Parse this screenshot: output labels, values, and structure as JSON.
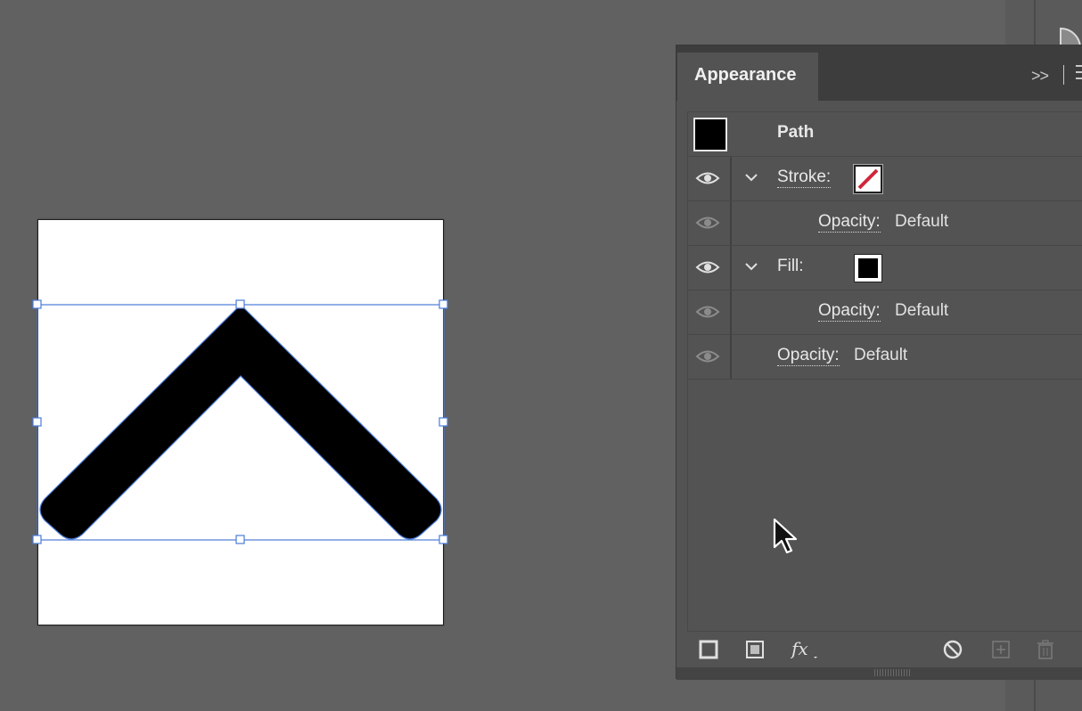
{
  "panel": {
    "tab_title": "Appearance",
    "collapse_glyph": ">>",
    "rows": {
      "path": {
        "label": "Path"
      },
      "stroke": {
        "label": "Stroke:",
        "swatch": "none"
      },
      "stroke_opacity": {
        "label": "Opacity:",
        "value": "Default"
      },
      "fill": {
        "label": "Fill:",
        "swatch": "black"
      },
      "fill_opacity": {
        "label": "Opacity:",
        "value": "Default"
      },
      "object_opacity": {
        "label": "Opacity:",
        "value": "Default"
      }
    },
    "footer_icons": [
      "add-new-stroke-icon",
      "add-new-fill-icon",
      "fx-icon",
      "clear-appearance-icon",
      "duplicate-item-icon",
      "delete-item-icon"
    ]
  },
  "colors": {
    "canvas": "#616161",
    "panel": "#535353",
    "selection": "#4a7bd9",
    "none_slash": "#d0263a"
  }
}
